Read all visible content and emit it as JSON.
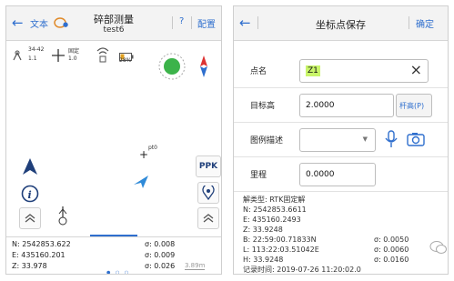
{
  "left_screen": {
    "header": {
      "back_icon": "arrow-left",
      "text_label": "文本",
      "title": "碎部测量",
      "subtitle": "test6",
      "help_label": "?",
      "config_label": "配置"
    },
    "status": {
      "sats": "34-42",
      "sats_val": "1.1",
      "fix_label": "固定",
      "fix_val": "1.0",
      "link_val": "?",
      "battery": "28%"
    },
    "point_label": "pt0",
    "ppk_label": "PPK",
    "bottom": {
      "n": "N: 2542853.622",
      "e": "E: 435160.201",
      "z": "Z: 33.978",
      "sn": "σ: 0.008",
      "se": "σ: 0.009",
      "sz": "σ: 0.026",
      "scale": "3.89m"
    }
  },
  "right_screen": {
    "header": {
      "back_icon": "arrow-left",
      "title": "坐标点保存",
      "confirm_label": "确定"
    },
    "fields": {
      "name_label": "点名",
      "name_value": "Z1",
      "height_label": "目标高",
      "height_value": "2.0000",
      "pole_button": "杆高(P)",
      "legend_label": "图例描述",
      "legend_value": "",
      "mileage_label": "里程",
      "mileage_value": "0.0000"
    },
    "info": {
      "solution": "解类型: RTK固定解",
      "n": "N: 2542853.6611",
      "e": "E: 435160.2493",
      "z": "Z: 33.9248",
      "b": "B: 22:59:00.71833N",
      "sb": "σ: 0.0050",
      "l": "L: 113:22:03.51042E",
      "sl": "σ: 0.0060",
      "h": "H: 33.9248",
      "sh": "σ: 0.0160",
      "time": "记录时间: 2019-07-26 11:20:02.0"
    }
  },
  "colors": {
    "accent": "#2f6fce",
    "green": "#3cb34a",
    "field_highlight": "#c9f56a"
  }
}
